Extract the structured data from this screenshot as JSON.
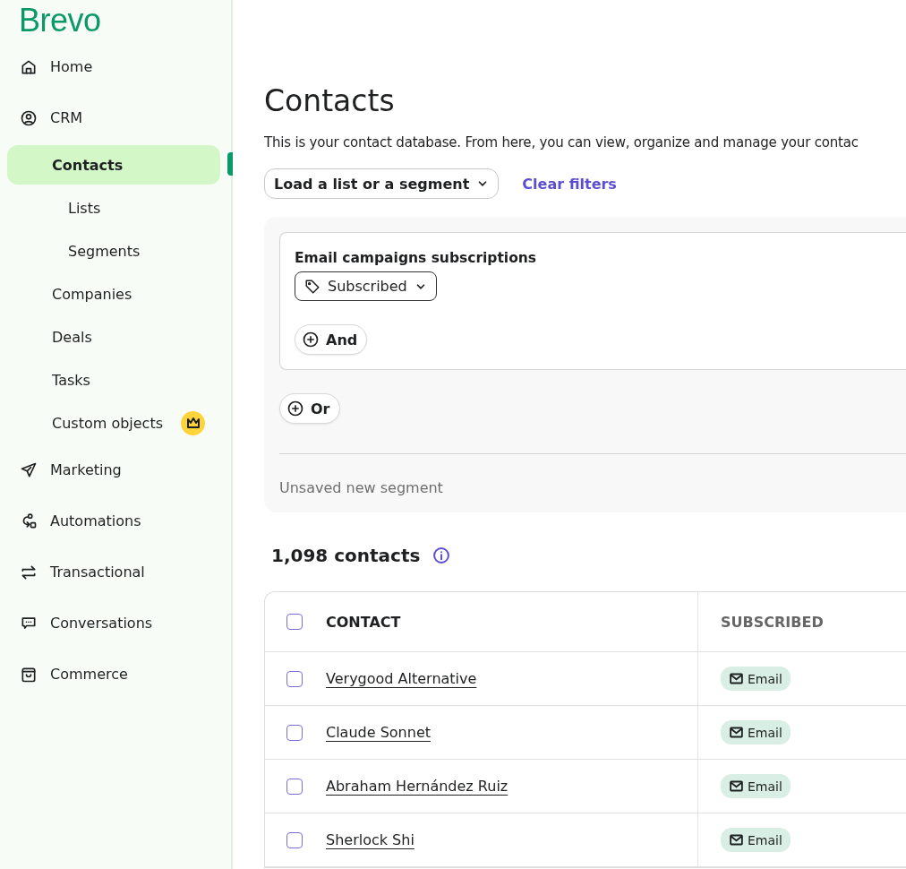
{
  "brand": {
    "name": "Brevo"
  },
  "sidebar": {
    "items": [
      {
        "label": "Home",
        "selected": false
      },
      {
        "label": "CRM",
        "selected": false,
        "children": [
          {
            "label": "Contacts",
            "selected": true,
            "children": [
              {
                "label": "Lists",
                "selected": false
              },
              {
                "label": "Segments",
                "selected": false
              }
            ]
          },
          {
            "label": "Companies",
            "selected": false
          },
          {
            "label": "Deals",
            "selected": false
          },
          {
            "label": "Tasks",
            "selected": false
          },
          {
            "label": "Custom objects",
            "selected": false,
            "premium": true
          }
        ]
      },
      {
        "label": "Marketing",
        "selected": false
      },
      {
        "label": "Automations",
        "selected": false
      },
      {
        "label": "Transactional",
        "selected": false
      },
      {
        "label": "Conversations",
        "selected": false
      },
      {
        "label": "Commerce",
        "selected": false
      }
    ]
  },
  "page": {
    "title": "Contacts",
    "description": "This is your contact database. From here, you can view, organize and manage your contac"
  },
  "filters": {
    "load_button": "Load a list or a segment",
    "clear_link": "Clear filters",
    "groups": [
      {
        "title": "Email campaigns subscriptions",
        "value": "Subscribed",
        "and_button": "And"
      }
    ],
    "or_button": "Or",
    "segment_name": "Unsaved new segment"
  },
  "count": {
    "label": "1,098 contacts"
  },
  "table": {
    "columns": [
      {
        "label": "CONTACT",
        "checked": false
      },
      {
        "label": "SUBSCRIBED"
      }
    ],
    "rows": [
      {
        "name": "Verygood Alternative",
        "checked": false,
        "channel": "Email"
      },
      {
        "name": "Claude Sonnet",
        "checked": false,
        "channel": "Email"
      },
      {
        "name": "Abraham Hernández Ruiz",
        "checked": false,
        "channel": "Email"
      },
      {
        "name": "Sherlock Shi",
        "checked": false,
        "channel": "Email"
      }
    ]
  }
}
